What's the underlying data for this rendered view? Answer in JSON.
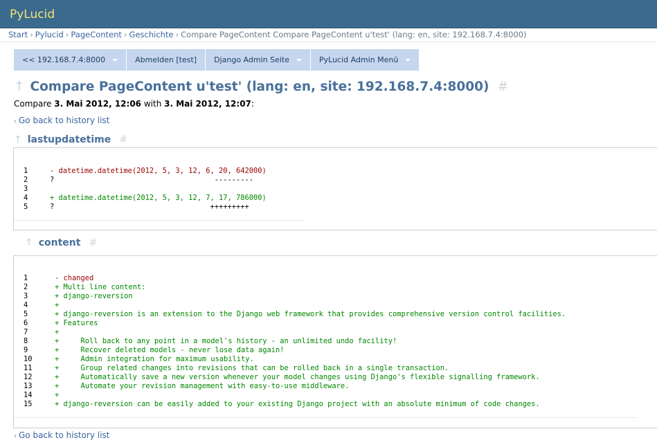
{
  "site": {
    "title": "PyLucid"
  },
  "breadcrumb": {
    "links": [
      "Start",
      "Pylucid",
      "PageContent",
      "Geschichte"
    ],
    "current": "Compare PageContent Compare PageContent u'test' (lang: en, site: 192.168.7.4:8000)"
  },
  "menu": [
    {
      "label": "<< 192.168.7.4:8000"
    },
    {
      "label": "Abmelden [test]"
    },
    {
      "label": "Django Admin Seite"
    },
    {
      "label": "PyLucid Admin Menü"
    }
  ],
  "page": {
    "title": "Compare PageContent u'test' (lang: en, site: 192.168.7.4:8000)",
    "compare_prefix": "Compare",
    "date_from": "3. Mai 2012, 12:06",
    "compare_with": "with",
    "date_to": "3. Mai 2012, 12:07",
    "compare_suffix": ":",
    "back_link": "Go back to history list"
  },
  "sections": [
    {
      "heading": "lastupdatetime",
      "lines": [
        {
          "num": "1",
          "text": "- datetime.datetime(2012, 5, 3, 12, 6, 20, 642000)",
          "kind": "minus"
        },
        {
          "num": "2",
          "text": "?                                     ---------",
          "kind": "neutral"
        },
        {
          "num": "3",
          "text": "",
          "kind": "neutral"
        },
        {
          "num": "4",
          "text": "+ datetime.datetime(2012, 5, 3, 12, 7, 17, 786000)",
          "kind": "plus"
        },
        {
          "num": "5",
          "text": "?                                    +++++++++",
          "kind": "neutral"
        }
      ]
    },
    {
      "heading": "content",
      "lines": [
        {
          "num": "1",
          "text": "- changed",
          "kind": "minus"
        },
        {
          "num": "2",
          "text": "+ Multi line content:",
          "kind": "plus"
        },
        {
          "num": "3",
          "text": "+ django-reversion",
          "kind": "plus"
        },
        {
          "num": "4",
          "text": "+",
          "kind": "plus"
        },
        {
          "num": "5",
          "text": "+ django-reversion is an extension to the Django web framework that provides comprehensive version control facilities.",
          "kind": "plus"
        },
        {
          "num": "6",
          "text": "+ Features",
          "kind": "plus"
        },
        {
          "num": "7",
          "text": "+",
          "kind": "plus"
        },
        {
          "num": "8",
          "text": "+     Roll back to any point in a model's history - an unlimited undo facility!",
          "kind": "plus"
        },
        {
          "num": "9",
          "text": "+     Recover deleted models - never lose data again!",
          "kind": "plus"
        },
        {
          "num": "10",
          "text": "+     Admin integration for maximum usability.",
          "kind": "plus"
        },
        {
          "num": "11",
          "text": "+     Group related changes into revisions that can be rolled back in a single transaction.",
          "kind": "plus"
        },
        {
          "num": "12",
          "text": "+     Automatically save a new version whenever your model changes using Django's flexible signalling framework.",
          "kind": "plus"
        },
        {
          "num": "13",
          "text": "+     Automate your revision management with easy-to-use middleware.",
          "kind": "plus"
        },
        {
          "num": "14",
          "text": "+",
          "kind": "plus"
        },
        {
          "num": "15",
          "text": "+ django-reversion can be easily added to your existing Django project with an absolute minimum of code changes.",
          "kind": "plus"
        }
      ]
    }
  ]
}
